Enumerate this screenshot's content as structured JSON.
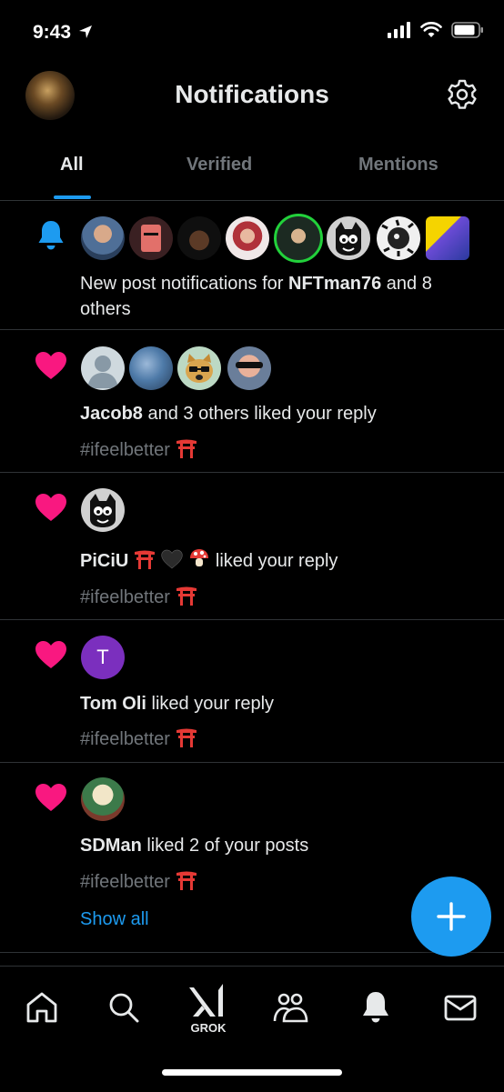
{
  "status_bar": {
    "time": "9:43"
  },
  "header": {
    "title": "Notifications"
  },
  "tabs": [
    {
      "label": "All",
      "active": true
    },
    {
      "label": "Verified",
      "active": false
    },
    {
      "label": "Mentions",
      "active": false
    }
  ],
  "notifications": [
    {
      "type": "new-post",
      "prefix": "New post notifications for ",
      "user": "NFTman76",
      "suffix": " and 8",
      "line2": "others"
    },
    {
      "type": "like",
      "user": "Jacob8",
      "text": " and 3 others liked your reply",
      "tag": "#ifeelbetter"
    },
    {
      "type": "like",
      "user": "PiCiU",
      "text": " liked your reply",
      "tag": "#ifeelbetter"
    },
    {
      "type": "like",
      "user": "Tom Oli",
      "avatar_letter": "T",
      "text": " liked your reply",
      "tag": "#ifeelbetter"
    },
    {
      "type": "like",
      "user": "SDMan",
      "text": " liked 2 of your posts",
      "tag": "#ifeelbetter",
      "show_all": "Show all"
    }
  ],
  "bottom_nav": {
    "items": [
      "home-icon",
      "search-icon",
      "grok-icon",
      "communities-icon",
      "notifications-bell-icon",
      "messages-icon"
    ],
    "grok_label": "GROK"
  },
  "colors": {
    "accent": "#1d9bf0",
    "like": "#f91880",
    "background": "#000000",
    "muted_text": "#71767b"
  }
}
